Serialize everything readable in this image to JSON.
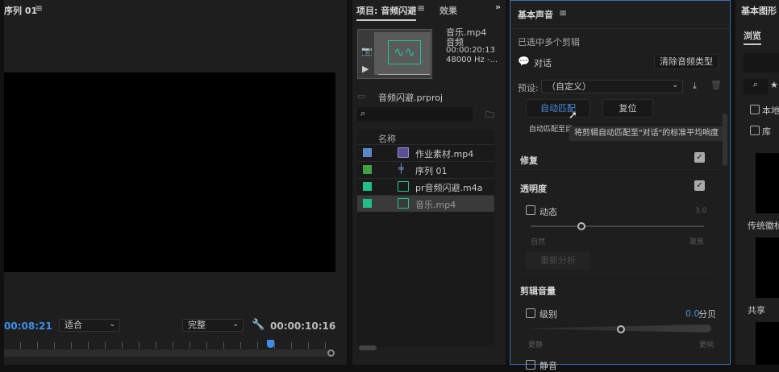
{
  "program_monitor": {
    "title": "序列 01",
    "menu_icon": "hamburger-icon",
    "current_time": "00:08:21",
    "fit_select": "适合",
    "quality_select": "完整",
    "duration": "00:00:10:16",
    "playhead_fraction": 0.8
  },
  "project_panel": {
    "tab_project": "项目: 音频闪避",
    "tab_effects": "效果",
    "preview": {
      "name": "音乐.mp4",
      "type": "音频",
      "duration": "00:00:20:13",
      "rate": "48000 Hz -..."
    },
    "project_file": "音频闪避.prproj",
    "search_placeholder": "",
    "column_name": "名称",
    "items": [
      {
        "name": "作业素材.mp4",
        "color": "#5b86c8",
        "icon": "video-audio-icon"
      },
      {
        "name": "序列 01",
        "color": "#3fa046",
        "icon": "sequence-icon"
      },
      {
        "name": "pr音频闪避.m4a",
        "color": "#1fbf8f",
        "icon": "audio-icon"
      },
      {
        "name": "音乐.mp4",
        "color": "#1fbf8f",
        "icon": "audio-icon",
        "selected": true
      }
    ]
  },
  "essential_sound": {
    "title": "基本声音",
    "status": "已选中多个剪辑",
    "type_label": "对话",
    "clear_type": "清除音频类型",
    "preset_label": "预设:",
    "preset_value": "（自定义）",
    "auto_match": "自动匹配",
    "reset": "复位",
    "auto_match_info": "自动匹配至目",
    "tooltip": "将剪辑自动匹配至\"对话\"的标准平均响度",
    "repair": {
      "label": "修复",
      "checked": true
    },
    "clarity": {
      "label": "透明度",
      "checked": true,
      "dynamics_label": "动态",
      "dynamics_value": "3.0",
      "slider_fraction": 0.3,
      "left": "自然",
      "right": "聚焦",
      "reanalyze": "重新分析"
    },
    "clip_volume": {
      "label": "剪辑音量",
      "level_label": "级别",
      "level_value": "0.0",
      "level_unit": "分贝",
      "slider_fraction": 0.5,
      "left": "更静",
      "right": "更响",
      "mute_label": "静音"
    }
  },
  "graphics_panel": {
    "title": "基本图形",
    "tab_browse": "浏览",
    "local": "本地",
    "library": "库",
    "section1": "传统徽标",
    "section2": "共享"
  }
}
